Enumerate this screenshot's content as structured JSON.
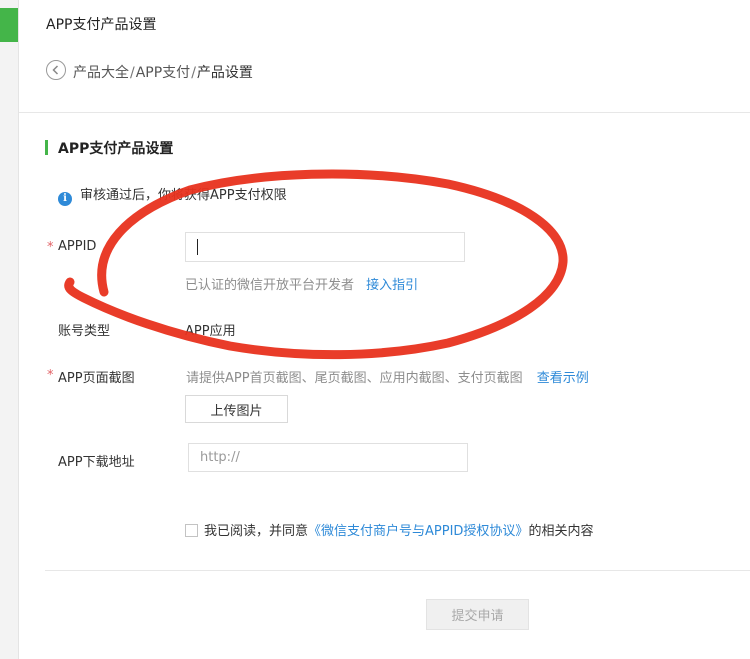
{
  "header": {
    "title": "APP支付产品设置",
    "breadcrumb": [
      "产品大全",
      "APP支付",
      "产品设置"
    ],
    "separator": "/"
  },
  "section": {
    "title": "APP支付产品设置"
  },
  "notice": {
    "icon": "info-icon",
    "text": "审核通过后，你将获得APP支付权限"
  },
  "form": {
    "appid": {
      "label": "APPID",
      "value": "",
      "hint": "已认证的微信开放平台开发者",
      "hint_link": "接入指引"
    },
    "account_type": {
      "label": "账号类型",
      "value": "APP应用"
    },
    "screenshots": {
      "label": "APP页面截图",
      "hint": "请提供APP首页截图、尾页截图、应用内截图、支付页截图",
      "hint_link": "查看示例",
      "upload_label": "上传图片"
    },
    "download_url": {
      "label": "APP下载地址",
      "placeholder": "http://"
    },
    "required_mark": "*"
  },
  "agreement": {
    "prefix": "我已阅读，并同意",
    "link": "《微信支付商户号与APPID授权协议》",
    "suffix": "的相关内容",
    "checked": false
  },
  "submit": {
    "label": "提交申请",
    "enabled": false
  },
  "colors": {
    "accent": "#44b549",
    "link": "#2e8ad8",
    "required": "#e15f63",
    "annotation": "#e8321e"
  }
}
